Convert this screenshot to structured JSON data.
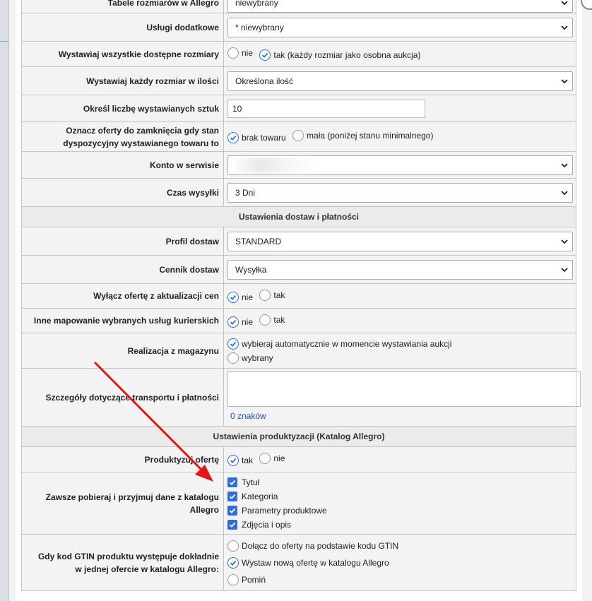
{
  "form": {
    "row_top": {
      "label": "Tabele rozmiarów w Allegro",
      "value": "niewybrany"
    },
    "uslugi": {
      "label": "Usługi dodatkowe",
      "value": "* niewybrany"
    },
    "wszystkie_rozmiary": {
      "label": "Wystawiaj wszystkie dostępne rozmiary",
      "opt_no": "nie",
      "opt_yes": "tak (każdy rozmiar jako osobna aukcja)"
    },
    "kazdy_rozmiar": {
      "label": "Wystawiaj każdy rozmiar w ilości",
      "value": "Określona ilość"
    },
    "liczba_sztuk": {
      "label": "Określ liczbę wystawianych sztuk",
      "value": "10"
    },
    "zamkniecie": {
      "label_line1": "Oznacz oferty do zamknięcia gdy stan",
      "label_line2": "dyspozycyjny wystawianego towaru to",
      "opt_a": "brak towaru",
      "opt_b": "mała (poniżej stanu minimalnego)"
    },
    "konto": {
      "label": "Konto w serwisie"
    },
    "czas_wysylki": {
      "label": "Czas wysyłki",
      "value": "3 Dni"
    },
    "section_dostawy": "Ustawienia dostaw i płatności",
    "profil": {
      "label": "Profil dostaw",
      "value": "STANDARD"
    },
    "cennik": {
      "label": "Cennik dostaw",
      "value": "Wysyłka"
    },
    "wylacz": {
      "label": "Wyłącz ofertę z aktualizacji cen",
      "opt_no": "nie",
      "opt_yes": "tak"
    },
    "mapowanie": {
      "label": "Inne mapowanie wybranych usług kurierskich",
      "opt_no": "nie",
      "opt_yes": "tak"
    },
    "realizacja": {
      "label": "Realizacja z magazynu",
      "opt_a": "wybieraj automatycznie w momencie wystawiania aukcji",
      "opt_b": "wybrany"
    },
    "szczegoly": {
      "label": "Szczegóły dotyczące transportu i płatności",
      "counter": "0 znaków"
    },
    "section_produkt": "Ustawienia produktyzacji (Katalog Allegro)",
    "produktyzuj": {
      "label": "Produktyzuj ofertę",
      "opt_yes": "tak",
      "opt_no": "nie"
    },
    "pobieraj": {
      "label_line1": "Zawsze pobieraj i przyjmuj dane z katalogu",
      "label_line2": "Allegro",
      "items": [
        "Tytuł",
        "Kategoria",
        "Parametry produktowe",
        "Zdjęcia i opis"
      ]
    },
    "gtin": {
      "label_line1": "Gdy kod GTIN produktu występuje dokładnie",
      "label_line2": "w jednej ofercie w katalogu Allegro:",
      "opt_a": "Dołącz do oferty na podstawie kodu GTIN",
      "opt_b": "Wystaw nową ofertę w katalogu Allegro",
      "opt_c": "Pomiń"
    }
  },
  "colors": {
    "accent": "#2f6ed6",
    "arrow": "#e8141a",
    "link": "#1f4fcf"
  }
}
